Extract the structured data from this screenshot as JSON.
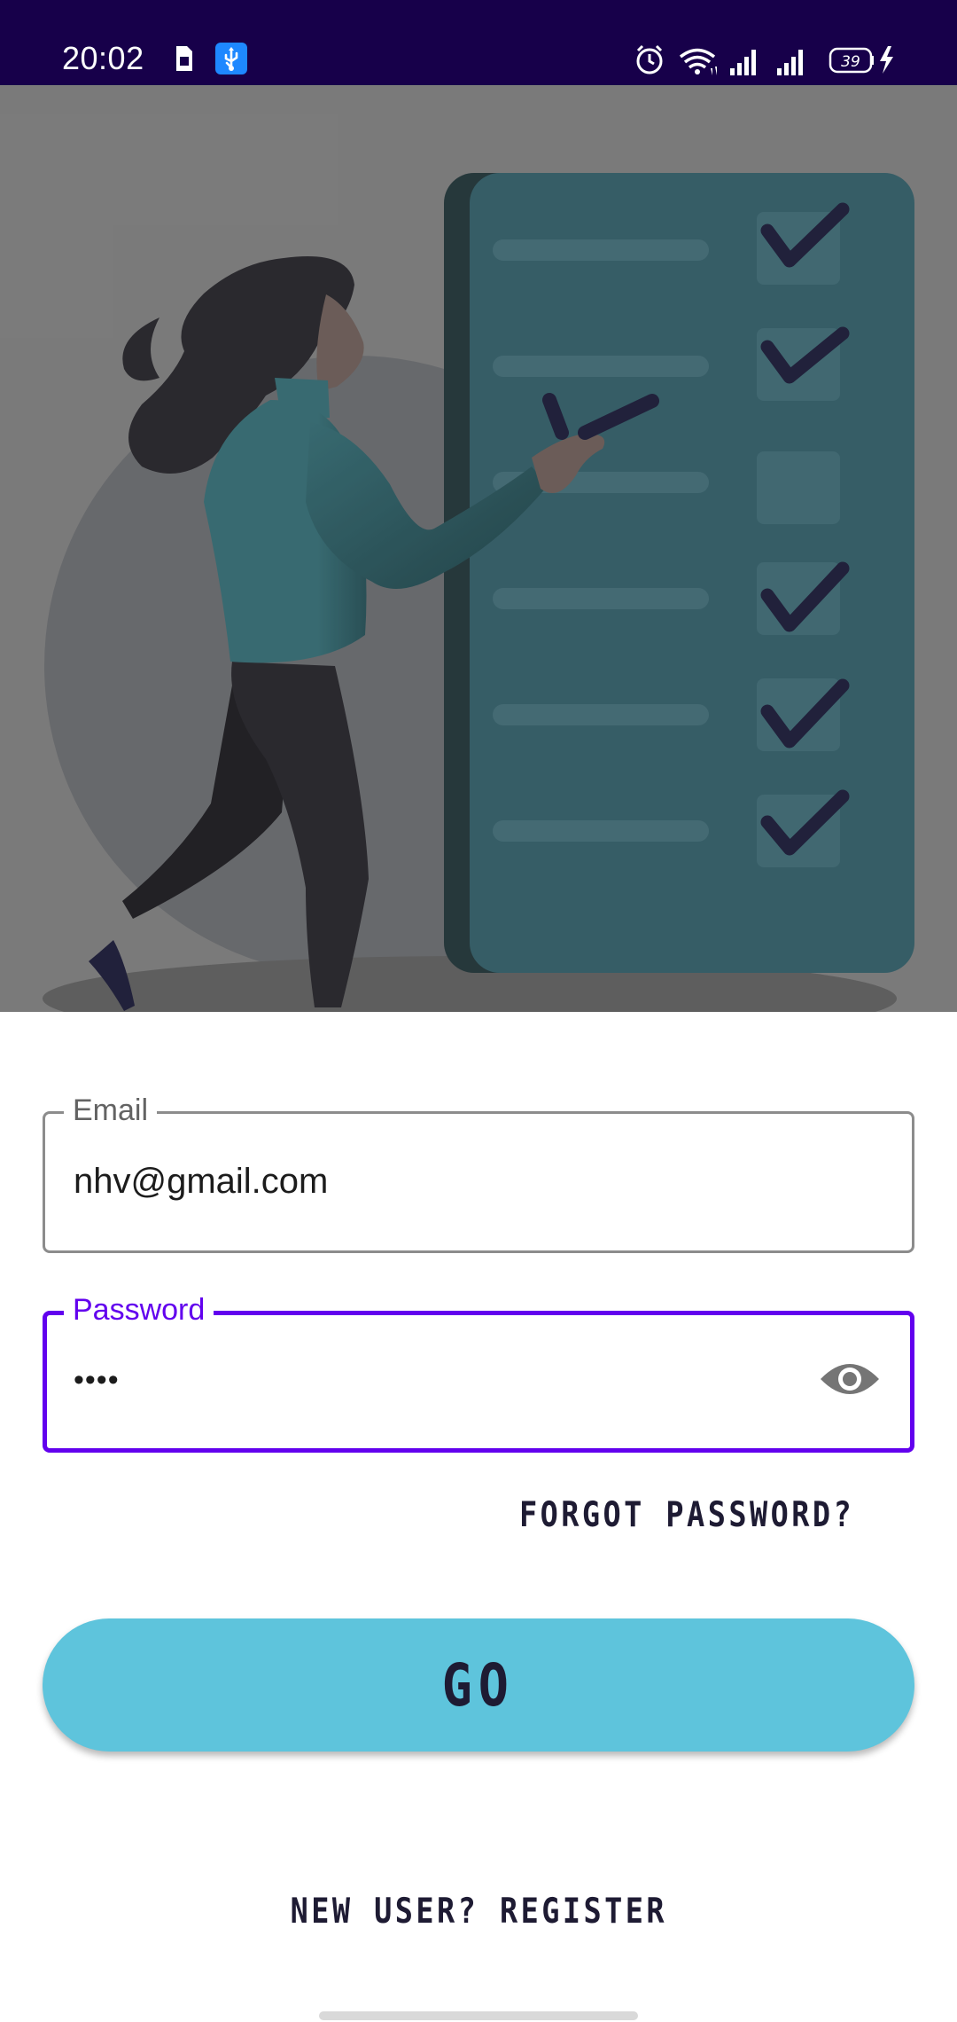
{
  "status_bar": {
    "time": "20:02",
    "battery_level": "39",
    "background_color": "#17004a",
    "icons_left": [
      "sim-card-icon",
      "usb-debugging-icon"
    ],
    "icons_right": [
      "alarm-icon",
      "wifi-icon",
      "signal-icon",
      "signal-icon",
      "battery-icon",
      "charging-bolt-icon"
    ]
  },
  "hero": {
    "illustration": "woman-checklist-illustration",
    "checkbox_states": [
      true,
      true,
      false,
      true,
      true,
      true
    ]
  },
  "login_form": {
    "email": {
      "label": "Email",
      "value": "nhv@gmail.com"
    },
    "password": {
      "label": "Password",
      "value": "••••",
      "toggle_icon": "eye-icon"
    },
    "forgot_password": "FORGOT PASSWORD?",
    "submit_label": "GO",
    "register_link": "NEW USER? REGISTER"
  },
  "colors": {
    "accent": "#6200ee",
    "button": "#5ec4dc",
    "text_dark": "#1e1b33"
  }
}
